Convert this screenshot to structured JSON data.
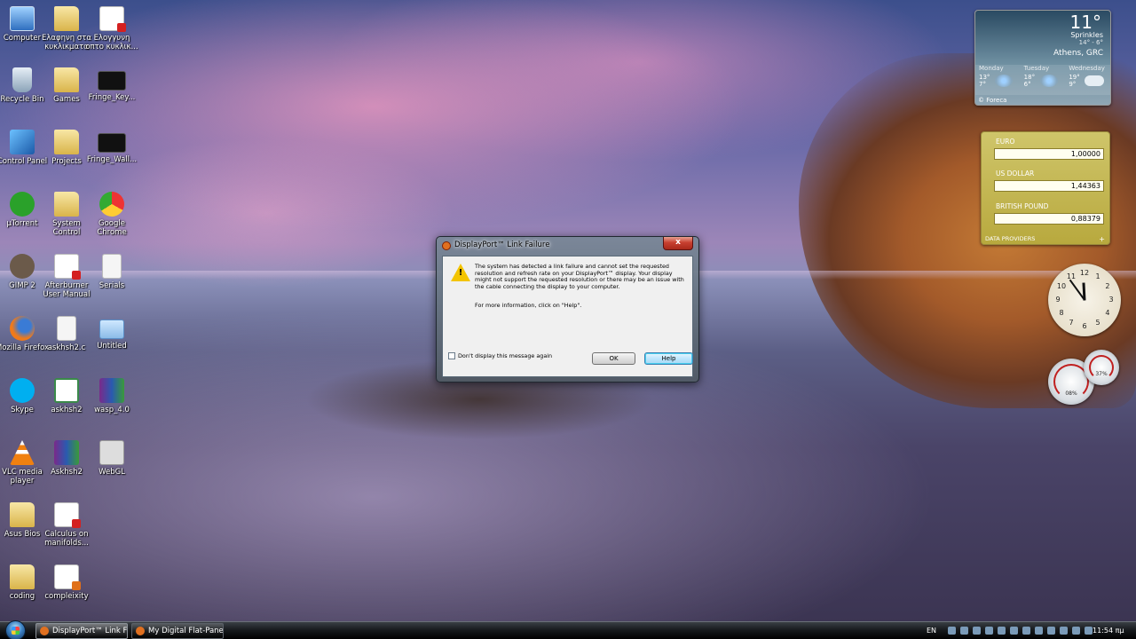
{
  "desktop_icons": [
    {
      "label": "Computer",
      "type": "computer"
    },
    {
      "label": "Ελαφηνη στα κυκλικματα",
      "type": "folder"
    },
    {
      "label": "Ελογγυνη οπτο κυκλικ...",
      "type": "pdf"
    },
    {
      "label": "Recycle Bin",
      "type": "bin"
    },
    {
      "label": "Games",
      "type": "folder"
    },
    {
      "label": "Fringe_Key...",
      "type": "dark"
    },
    {
      "label": "Control Panel",
      "type": "cp"
    },
    {
      "label": "Projects",
      "type": "folder"
    },
    {
      "label": "Fringe_Wall...",
      "type": "dark"
    },
    {
      "label": "µTorrent",
      "type": "ut"
    },
    {
      "label": "System Control",
      "type": "folder"
    },
    {
      "label": "Google Chrome",
      "type": "chrome"
    },
    {
      "label": "GIMP 2",
      "type": "gimp"
    },
    {
      "label": "Afterburner User Manual",
      "type": "pdf"
    },
    {
      "label": "Serials",
      "type": "file"
    },
    {
      "label": "Mozilla Firefox",
      "type": "firefox"
    },
    {
      "label": "askhsh2.c",
      "type": "file"
    },
    {
      "label": "Untitled",
      "type": "window"
    },
    {
      "label": "Skype",
      "type": "skype"
    },
    {
      "label": "askhsh2",
      "type": "green"
    },
    {
      "label": "wasp_4.0",
      "type": "rar"
    },
    {
      "label": "VLC media player",
      "type": "vlc"
    },
    {
      "label": "Askhsh2",
      "type": "rar"
    },
    {
      "label": "WebGL",
      "type": "webgl"
    },
    {
      "label": "Asus Bios",
      "type": "folder"
    },
    {
      "label": "Calculus on manifolds...",
      "type": "pdf"
    },
    {
      "label": "coding",
      "type": "folder"
    },
    {
      "label": "compleixity",
      "type": "ppt"
    }
  ],
  "weather": {
    "temp": "11°",
    "condition": "Sprinkles",
    "hilo": "14° - 6°",
    "city": "Athens, GRC",
    "days": [
      {
        "name": "Monday",
        "high": "13°",
        "low": "7°",
        "icon": "rain"
      },
      {
        "name": "Tuesday",
        "high": "18°",
        "low": "6°",
        "icon": "rain"
      },
      {
        "name": "Wednesday",
        "high": "19°",
        "low": "9°",
        "icon": "cloud"
      }
    ],
    "source": "© Foreca"
  },
  "currency": {
    "rows": [
      {
        "name": "EURO",
        "value": "1,00000"
      },
      {
        "name": "US DOLLAR",
        "value": "1,44363"
      },
      {
        "name": "BRITISH POUND",
        "value": "0,88379"
      }
    ],
    "footer": "DATA PROVIDERS",
    "plus": "+"
  },
  "clock": {
    "numbers": [
      "12",
      "1",
      "2",
      "3",
      "4",
      "5",
      "6",
      "7",
      "8",
      "9",
      "10",
      "11"
    ],
    "hour": 11,
    "minute": 54
  },
  "meters": {
    "cpu_label": "08%",
    "ram_label": "37%"
  },
  "dialog": {
    "title": "DisplayPort™ Link Failure",
    "close": "x",
    "message": "The system has detected a link failure and cannot set the requested resolution and refresh rate on your DisplayPort™ display. Your display might not support the requested resolution or there may be an issue with the cable connecting the display to your computer.",
    "info": "For more information, click on \"Help\".",
    "checkbox_label": "Don't display this message again",
    "ok_label": "OK",
    "help_label": "Help"
  },
  "taskbar": {
    "tasks": [
      {
        "label": "DisplayPort™ Link Fa...",
        "active": true
      },
      {
        "label": "My Digital Flat-Panel...",
        "active": false
      }
    ],
    "language": "EN",
    "time": "11:54 πμ"
  }
}
